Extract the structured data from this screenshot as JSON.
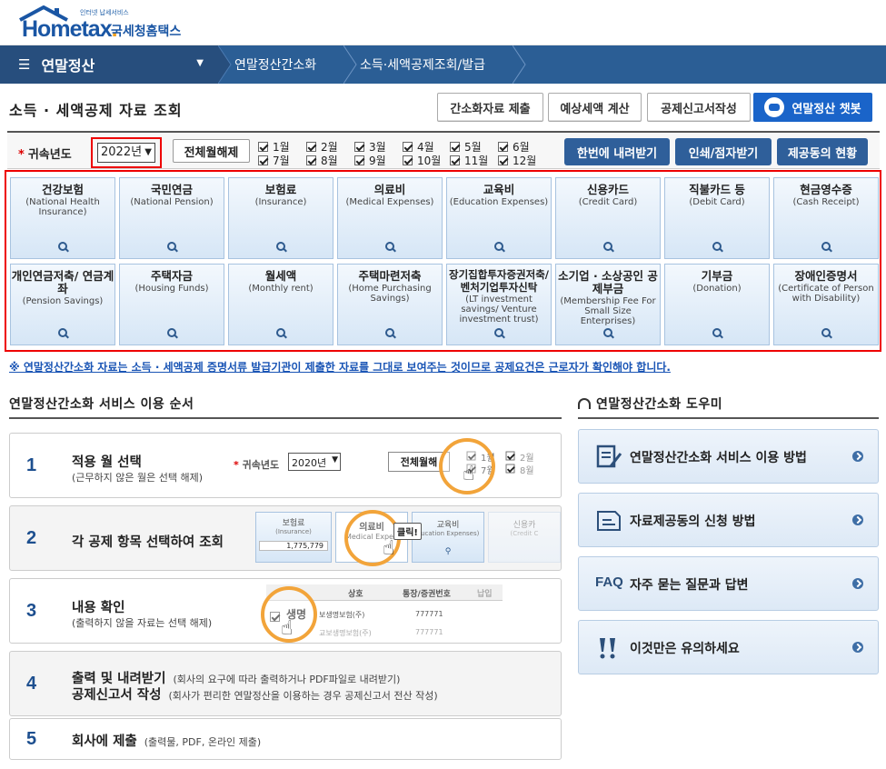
{
  "header": {
    "logo_sub": "인터넷 납세서비스",
    "logo_main_a": "Hom",
    "logo_main_b": "e",
    "logo_main_c": "tax",
    "logo_main_dot": ".",
    "logo_kr": "국세청홈택스"
  },
  "nav": {
    "menu_label": "연말정산",
    "crumbs": [
      "연말정산간소화",
      "소득·세액공제조회/발급"
    ]
  },
  "title": {
    "text": "소득 · 세액공제 자료 조회",
    "buttons": [
      "간소화자료 제출",
      "예상세액 계산",
      "공제신고서작성"
    ],
    "chatbot": "연말정산 챗봇"
  },
  "filter": {
    "label": "귀속년도",
    "year_value": "2022년",
    "clear_all": "전체월해제",
    "months_top": [
      "1월",
      "2월",
      "3월",
      "4월",
      "5월",
      "6월"
    ],
    "months_bottom": [
      "7월",
      "8월",
      "9월",
      "10월",
      "11월",
      "12월"
    ],
    "actions": [
      "한번에 내려받기",
      "인쇄/점자받기",
      "제공동의 현황"
    ]
  },
  "categories": [
    {
      "name": "건강보험",
      "en": "(National Health Insurance)"
    },
    {
      "name": "국민연금",
      "en": "(National Pension)"
    },
    {
      "name": "보험료",
      "en": "(Insurance)"
    },
    {
      "name": "의료비",
      "en": "(Medical Expenses)"
    },
    {
      "name": "교육비",
      "en": "(Education Expenses)"
    },
    {
      "name": "신용카드",
      "en": "(Credit Card)"
    },
    {
      "name": "직불카드 등",
      "en": "(Debit Card)"
    },
    {
      "name": "현금영수증",
      "en": "(Cash Receipt)"
    },
    {
      "name": "개인연금저축/ 연금계좌",
      "en": "(Pension Savings)"
    },
    {
      "name": "주택자금",
      "en": "(Housing Funds)"
    },
    {
      "name": "월세액",
      "en": "(Monthly rent)"
    },
    {
      "name": "주택마련저축",
      "en": "(Home Purchasing Savings)"
    },
    {
      "name": "장기집합투자증권저축/ 벤처기업투자신탁",
      "en": "(LT investment savings/ Venture investment trust)"
    },
    {
      "name": "소기업 · 소상공인 공제부금",
      "en": "(Membership Fee For Small Size Enterprises)"
    },
    {
      "name": "기부금",
      "en": "(Donation)"
    },
    {
      "name": "장애인증명서",
      "en": "(Certificate of Person with Disability)"
    }
  ],
  "notice": "※ 연말정산간소화 자료는 소득 · 세액공제 증명서류 발급기관이 제출한 자료를 그대로 보여주는 것이므로 공제요건은 근로자가 확인해야 합니다.",
  "order": {
    "title": "연말정산간소화 서비스 이용 순서",
    "steps": [
      {
        "num": "1",
        "title": "적용 월 선택",
        "sub": "(근무하지 않은 월은 선택 해제)"
      },
      {
        "num": "2",
        "title": "각 공제 항목 선택하여 조회",
        "sub": ""
      },
      {
        "num": "3",
        "title": "내용 확인",
        "sub": "(출력하지 않을 자료는 선택 해제)"
      },
      {
        "num": "4",
        "title": "출력 및 내려받기",
        "title2": "공제신고서 작성",
        "sub": "(회사의 요구에 따라 출력하거나 PDF파일로 내려받기)",
        "sub2": "(회사가 편리한 연말정산을 이용하는 경우 공제신고서 전산 작성)"
      },
      {
        "num": "5",
        "title": "회사에 제출",
        "sub": "(출력물, PDF, 온라인 제출)"
      }
    ],
    "demo1": {
      "label": "귀속년도",
      "year": "2020년",
      "clear": "전체월해",
      "m1": "1월",
      "m7": "7월",
      "m2": "2월",
      "m8": "8월"
    },
    "demo2": {
      "t1": "보험료",
      "e1": "(Insurance)",
      "v1": "1,775,779",
      "t2": "의료비",
      "e2": "Medical Expen",
      "t3": "교육비",
      "e3": "ducation Expenses)",
      "t4": "신용카",
      "e4": "(Credit C",
      "click": "클릭!"
    },
    "demo3": {
      "h1": "상호",
      "h2": "통장/증권번호",
      "h3": "납입",
      "r1a": "생명",
      "r1b": "보생명보험(주)",
      "r1c": "777771",
      "r2": "교보생명보험(주)",
      "r2c": "777771"
    }
  },
  "helper": {
    "title": "연말정산간소화 도우미",
    "items": [
      "연말정산간소화 서비스 이용 방법",
      "자료제공동의 신청 방법",
      "자주 묻는 질문과 답변",
      "이것만은 유의하세요"
    ],
    "faq_label": "FAQ"
  }
}
